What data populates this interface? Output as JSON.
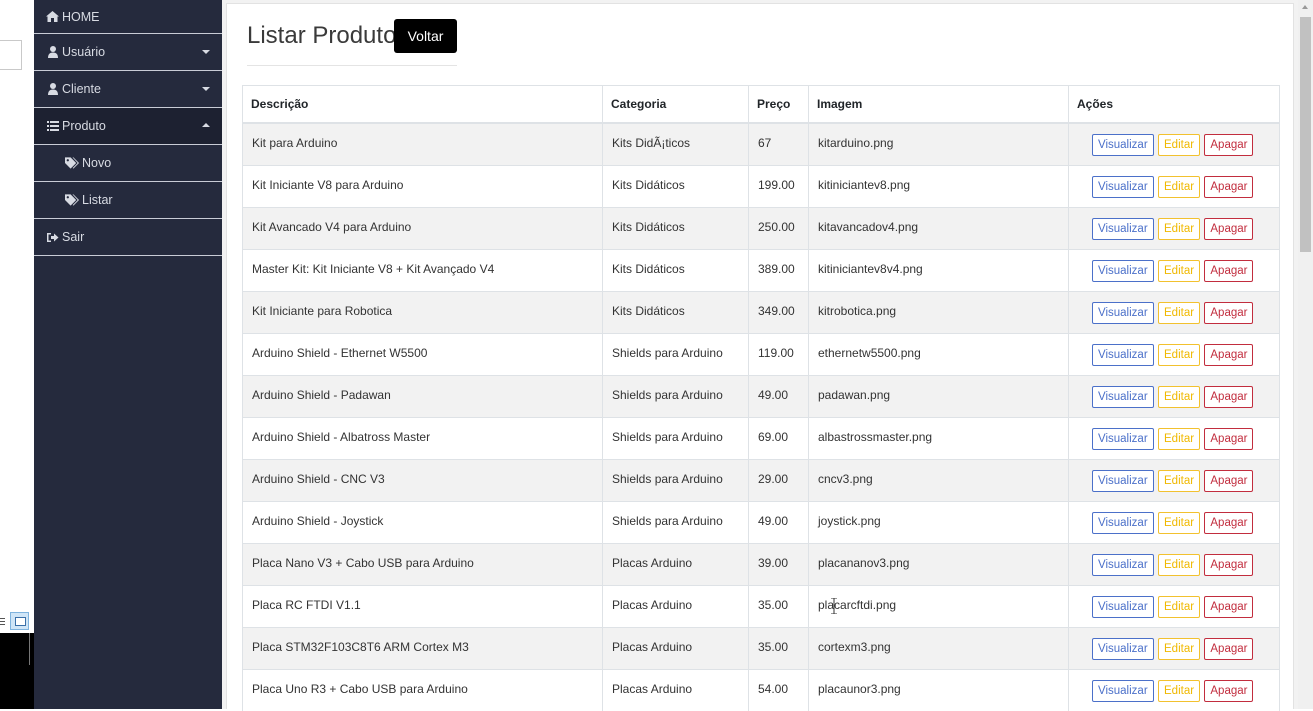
{
  "sidebar": {
    "items": [
      {
        "label": "HOME",
        "icon": "home-icon"
      },
      {
        "label": "Usuário",
        "icon": "user-icon"
      },
      {
        "label": "Cliente",
        "icon": "user-icon"
      },
      {
        "label": "Produto",
        "icon": "list-icon"
      },
      {
        "label": "Novo",
        "icon": "tags-icon"
      },
      {
        "label": "Listar",
        "icon": "tags-icon"
      },
      {
        "label": "Sair",
        "icon": "sign-out-icon"
      }
    ]
  },
  "page": {
    "title": "Listar Produto",
    "back_label": "Voltar"
  },
  "table": {
    "headers": [
      "Descrição",
      "Categoria",
      "Preço",
      "Imagem",
      "Ações"
    ],
    "rows": [
      {
        "descricao": "Kit para Arduino",
        "categoria": "Kits DidÃ¡ticos",
        "preco": "67",
        "imagem": "kitarduino.png"
      },
      {
        "descricao": "Kit Iniciante V8 para Arduino",
        "categoria": "Kits Didáticos",
        "preco": "199.00",
        "imagem": "kitiniciantev8.png"
      },
      {
        "descricao": "Kit Avancado V4 para Arduino",
        "categoria": "Kits Didáticos",
        "preco": "250.00",
        "imagem": "kitavancadov4.png"
      },
      {
        "descricao": "Master Kit: Kit Iniciante V8 + Kit Avançado V4",
        "categoria": "Kits Didáticos",
        "preco": "389.00",
        "imagem": "kitiniciantev8v4.png"
      },
      {
        "descricao": "Kit Iniciante para Robotica",
        "categoria": "Kits Didáticos",
        "preco": "349.00",
        "imagem": "kitrobotica.png"
      },
      {
        "descricao": "Arduino Shield - Ethernet W5500",
        "categoria": "Shields para Arduino",
        "preco": "119.00",
        "imagem": "ethernetw5500.png"
      },
      {
        "descricao": "Arduino Shield - Padawan",
        "categoria": "Shields para Arduino",
        "preco": "49.00",
        "imagem": "padawan.png"
      },
      {
        "descricao": "Arduino Shield - Albatross Master",
        "categoria": "Shields para Arduino",
        "preco": "69.00",
        "imagem": "albastrossmaster.png"
      },
      {
        "descricao": "Arduino Shield - CNC V3",
        "categoria": "Shields para Arduino",
        "preco": "29.00",
        "imagem": "cncv3.png"
      },
      {
        "descricao": "Arduino Shield - Joystick",
        "categoria": "Shields para Arduino",
        "preco": "49.00",
        "imagem": "joystick.png"
      },
      {
        "descricao": "Placa Nano V3 + Cabo USB para Arduino",
        "categoria": "Placas Arduino",
        "preco": "39.00",
        "imagem": "placananov3.png"
      },
      {
        "descricao": "Placa RC FTDI V1.1",
        "categoria": "Placas Arduino",
        "preco": "35.00",
        "imagem": "placarcftdi.png"
      },
      {
        "descricao": "Placa STM32F103C8T6 ARM Cortex M3",
        "categoria": "Placas Arduino",
        "preco": "35.00",
        "imagem": "cortexm3.png"
      },
      {
        "descricao": "Placa Uno R3 + Cabo USB para Arduino",
        "categoria": "Placas Arduino",
        "preco": "54.00",
        "imagem": "placaunor3.png"
      }
    ],
    "actions": {
      "view_label": "Visualizar",
      "edit_label": "Editar",
      "delete_label": "Apagar"
    }
  },
  "colors": {
    "sidebar_bg": "#252a3d",
    "view": "#4b70c9",
    "edit": "#f0b900",
    "delete": "#c22d3e"
  }
}
